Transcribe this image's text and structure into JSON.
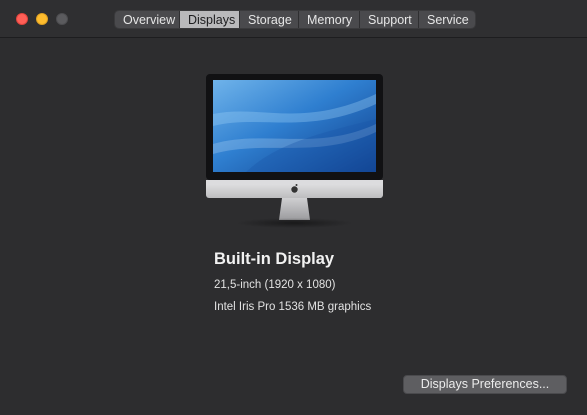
{
  "window": {
    "traffic_lights": {
      "close_color": "#ff5f57",
      "minimize_color": "#febc2e",
      "zoom_color": "#5b5b5e"
    },
    "tabs": [
      {
        "label": "Overview",
        "selected": false
      },
      {
        "label": "Displays",
        "selected": true
      },
      {
        "label": "Storage",
        "selected": false
      },
      {
        "label": "Memory",
        "selected": false
      },
      {
        "label": "Support",
        "selected": false
      },
      {
        "label": "Service",
        "selected": false
      }
    ]
  },
  "display": {
    "image_icon": "imac-icon",
    "name": "Built-in Display",
    "size": "21,5-inch (1920 x 1080)",
    "graphics": "Intel Iris Pro 1536 MB graphics"
  },
  "actions": {
    "preferences_label": "Displays Preferences..."
  }
}
